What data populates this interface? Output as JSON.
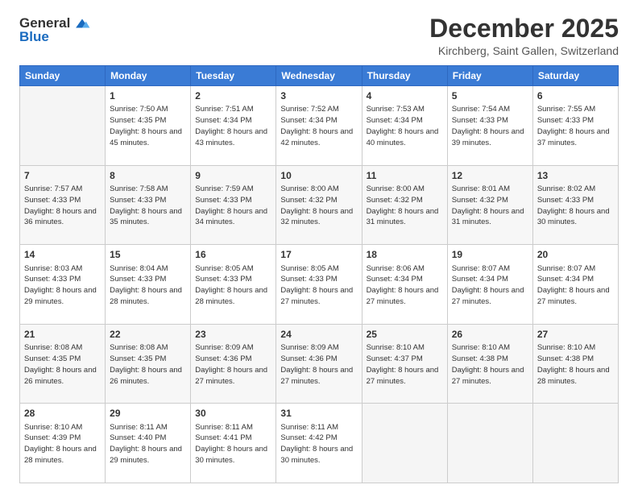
{
  "logo": {
    "general": "General",
    "blue": "Blue"
  },
  "title": "December 2025",
  "location": "Kirchberg, Saint Gallen, Switzerland",
  "header_days": [
    "Sunday",
    "Monday",
    "Tuesday",
    "Wednesday",
    "Thursday",
    "Friday",
    "Saturday"
  ],
  "weeks": [
    [
      {
        "day": "",
        "sunrise": "",
        "sunset": "",
        "daylight": ""
      },
      {
        "day": "1",
        "sunrise": "Sunrise: 7:50 AM",
        "sunset": "Sunset: 4:35 PM",
        "daylight": "Daylight: 8 hours and 45 minutes."
      },
      {
        "day": "2",
        "sunrise": "Sunrise: 7:51 AM",
        "sunset": "Sunset: 4:34 PM",
        "daylight": "Daylight: 8 hours and 43 minutes."
      },
      {
        "day": "3",
        "sunrise": "Sunrise: 7:52 AM",
        "sunset": "Sunset: 4:34 PM",
        "daylight": "Daylight: 8 hours and 42 minutes."
      },
      {
        "day": "4",
        "sunrise": "Sunrise: 7:53 AM",
        "sunset": "Sunset: 4:34 PM",
        "daylight": "Daylight: 8 hours and 40 minutes."
      },
      {
        "day": "5",
        "sunrise": "Sunrise: 7:54 AM",
        "sunset": "Sunset: 4:33 PM",
        "daylight": "Daylight: 8 hours and 39 minutes."
      },
      {
        "day": "6",
        "sunrise": "Sunrise: 7:55 AM",
        "sunset": "Sunset: 4:33 PM",
        "daylight": "Daylight: 8 hours and 37 minutes."
      }
    ],
    [
      {
        "day": "7",
        "sunrise": "Sunrise: 7:57 AM",
        "sunset": "Sunset: 4:33 PM",
        "daylight": "Daylight: 8 hours and 36 minutes."
      },
      {
        "day": "8",
        "sunrise": "Sunrise: 7:58 AM",
        "sunset": "Sunset: 4:33 PM",
        "daylight": "Daylight: 8 hours and 35 minutes."
      },
      {
        "day": "9",
        "sunrise": "Sunrise: 7:59 AM",
        "sunset": "Sunset: 4:33 PM",
        "daylight": "Daylight: 8 hours and 34 minutes."
      },
      {
        "day": "10",
        "sunrise": "Sunrise: 8:00 AM",
        "sunset": "Sunset: 4:32 PM",
        "daylight": "Daylight: 8 hours and 32 minutes."
      },
      {
        "day": "11",
        "sunrise": "Sunrise: 8:00 AM",
        "sunset": "Sunset: 4:32 PM",
        "daylight": "Daylight: 8 hours and 31 minutes."
      },
      {
        "day": "12",
        "sunrise": "Sunrise: 8:01 AM",
        "sunset": "Sunset: 4:32 PM",
        "daylight": "Daylight: 8 hours and 31 minutes."
      },
      {
        "day": "13",
        "sunrise": "Sunrise: 8:02 AM",
        "sunset": "Sunset: 4:33 PM",
        "daylight": "Daylight: 8 hours and 30 minutes."
      }
    ],
    [
      {
        "day": "14",
        "sunrise": "Sunrise: 8:03 AM",
        "sunset": "Sunset: 4:33 PM",
        "daylight": "Daylight: 8 hours and 29 minutes."
      },
      {
        "day": "15",
        "sunrise": "Sunrise: 8:04 AM",
        "sunset": "Sunset: 4:33 PM",
        "daylight": "Daylight: 8 hours and 28 minutes."
      },
      {
        "day": "16",
        "sunrise": "Sunrise: 8:05 AM",
        "sunset": "Sunset: 4:33 PM",
        "daylight": "Daylight: 8 hours and 28 minutes."
      },
      {
        "day": "17",
        "sunrise": "Sunrise: 8:05 AM",
        "sunset": "Sunset: 4:33 PM",
        "daylight": "Daylight: 8 hours and 27 minutes."
      },
      {
        "day": "18",
        "sunrise": "Sunrise: 8:06 AM",
        "sunset": "Sunset: 4:34 PM",
        "daylight": "Daylight: 8 hours and 27 minutes."
      },
      {
        "day": "19",
        "sunrise": "Sunrise: 8:07 AM",
        "sunset": "Sunset: 4:34 PM",
        "daylight": "Daylight: 8 hours and 27 minutes."
      },
      {
        "day": "20",
        "sunrise": "Sunrise: 8:07 AM",
        "sunset": "Sunset: 4:34 PM",
        "daylight": "Daylight: 8 hours and 27 minutes."
      }
    ],
    [
      {
        "day": "21",
        "sunrise": "Sunrise: 8:08 AM",
        "sunset": "Sunset: 4:35 PM",
        "daylight": "Daylight: 8 hours and 26 minutes."
      },
      {
        "day": "22",
        "sunrise": "Sunrise: 8:08 AM",
        "sunset": "Sunset: 4:35 PM",
        "daylight": "Daylight: 8 hours and 26 minutes."
      },
      {
        "day": "23",
        "sunrise": "Sunrise: 8:09 AM",
        "sunset": "Sunset: 4:36 PM",
        "daylight": "Daylight: 8 hours and 27 minutes."
      },
      {
        "day": "24",
        "sunrise": "Sunrise: 8:09 AM",
        "sunset": "Sunset: 4:36 PM",
        "daylight": "Daylight: 8 hours and 27 minutes."
      },
      {
        "day": "25",
        "sunrise": "Sunrise: 8:10 AM",
        "sunset": "Sunset: 4:37 PM",
        "daylight": "Daylight: 8 hours and 27 minutes."
      },
      {
        "day": "26",
        "sunrise": "Sunrise: 8:10 AM",
        "sunset": "Sunset: 4:38 PM",
        "daylight": "Daylight: 8 hours and 27 minutes."
      },
      {
        "day": "27",
        "sunrise": "Sunrise: 8:10 AM",
        "sunset": "Sunset: 4:38 PM",
        "daylight": "Daylight: 8 hours and 28 minutes."
      }
    ],
    [
      {
        "day": "28",
        "sunrise": "Sunrise: 8:10 AM",
        "sunset": "Sunset: 4:39 PM",
        "daylight": "Daylight: 8 hours and 28 minutes."
      },
      {
        "day": "29",
        "sunrise": "Sunrise: 8:11 AM",
        "sunset": "Sunset: 4:40 PM",
        "daylight": "Daylight: 8 hours and 29 minutes."
      },
      {
        "day": "30",
        "sunrise": "Sunrise: 8:11 AM",
        "sunset": "Sunset: 4:41 PM",
        "daylight": "Daylight: 8 hours and 30 minutes."
      },
      {
        "day": "31",
        "sunrise": "Sunrise: 8:11 AM",
        "sunset": "Sunset: 4:42 PM",
        "daylight": "Daylight: 8 hours and 30 minutes."
      },
      {
        "day": "",
        "sunrise": "",
        "sunset": "",
        "daylight": ""
      },
      {
        "day": "",
        "sunrise": "",
        "sunset": "",
        "daylight": ""
      },
      {
        "day": "",
        "sunrise": "",
        "sunset": "",
        "daylight": ""
      }
    ]
  ]
}
